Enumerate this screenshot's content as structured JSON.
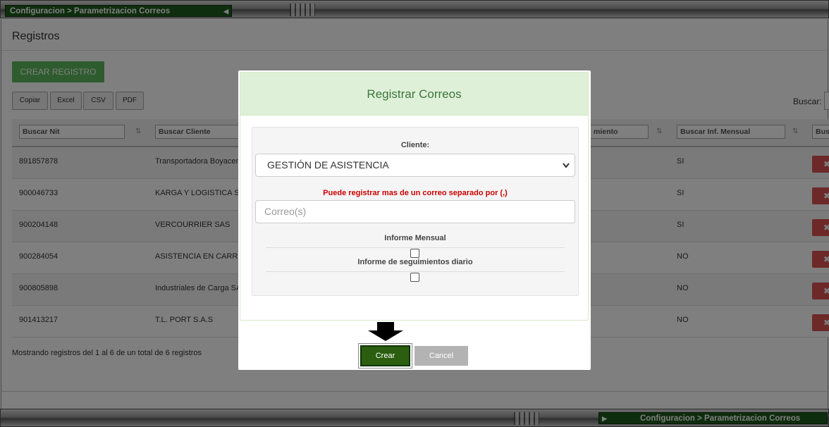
{
  "breadcrumb": "Configuracion > Parametrizacion Correos",
  "page": {
    "title": "Registros",
    "create_button": "CREAR REGISTRO",
    "export_buttons": [
      "Copiar",
      "Excel",
      "CSV",
      "PDF"
    ],
    "search_label": "Buscar:",
    "footer_info": "Mostrando registros del 1 al 6 de un total de 6 registros"
  },
  "table": {
    "filters": [
      "Buscar Nit",
      "Buscar Cliente",
      "miento",
      "Buscar Inf. Mensual",
      "Bus"
    ],
    "rows": [
      {
        "nit": "891857878",
        "cliente": "Transportadora Boyacen",
        "mensual": "SI"
      },
      {
        "nit": "900046733",
        "cliente": "KARGA Y LOGISTICA S",
        "mensual": "SI"
      },
      {
        "nit": "900204148",
        "cliente": "VERCOURRIER SAS",
        "mensual": "SI"
      },
      {
        "nit": "900284054",
        "cliente": "ASISTENCIA EN CARRE",
        "mensual": "NO"
      },
      {
        "nit": "900805898",
        "cliente": "Industriales de Carga SA",
        "mensual": "NO"
      },
      {
        "nit": "901413217",
        "cliente": "T.L. PORT S.A.S",
        "mensual": "NO"
      }
    ],
    "delete_glyph": "✖"
  },
  "modal": {
    "title": "Registrar Correos",
    "client_label": "Cliente:",
    "client_value": "GESTIÓN DE ASISTENCIA",
    "hint": "Puede registrar mas de un correo separado por (,)",
    "email_placeholder": "Correo(s)",
    "monthly_label": "Informe Mensual",
    "daily_label": "Informe de seguimientos diario",
    "create_button": "Crear",
    "cancel_button": "Cancel"
  },
  "colors": {
    "accent_green": "#5cb85c",
    "modal_header_bg": "#dff0d8",
    "modal_title": "#3c763d",
    "danger": "#d9534f",
    "hint_red": "#cc0000",
    "crumb_bg": "#1c5a1c"
  },
  "icons": {
    "sort": "sort-icon",
    "delete": "delete-icon",
    "chevron": "chevron-down-icon",
    "arrow": "down-arrow-icon"
  }
}
